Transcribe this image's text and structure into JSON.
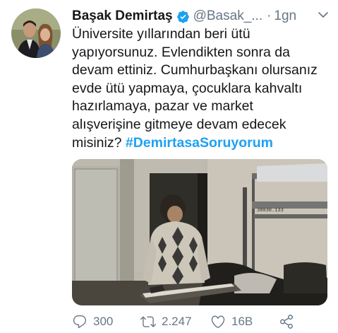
{
  "tweet": {
    "author_name": "Başak Demirtaş",
    "handle": "@Basak_...",
    "separator": "·",
    "time": "1gn",
    "text_lines": [
      "Üniversite yıllarından beri ütü",
      "yapıyorsunuz. Evlendikten sonra da",
      "devam ettiniz. Cumhurbaşkanı olursanız",
      "evde ütü yapmaya, çocuklara kahvaltı",
      "hazırlamaya, pazar ve market",
      "alışverişine  gitmeye devam edecek",
      "misiniz? "
    ],
    "hashtag": "#DemirtasaSoruyorum",
    "media_caption_on_bed": "38030.133"
  },
  "actions": {
    "replies": "300",
    "retweets": "2.247",
    "likes": "16B"
  },
  "colors": {
    "accent": "#1da1f2",
    "muted": "#657786",
    "text": "#14171a"
  },
  "icons": {
    "verified": "verified-badge-icon",
    "caret": "chevron-down-icon",
    "reply": "reply-icon",
    "retweet": "retweet-icon",
    "like": "heart-icon",
    "share": "share-icon"
  }
}
